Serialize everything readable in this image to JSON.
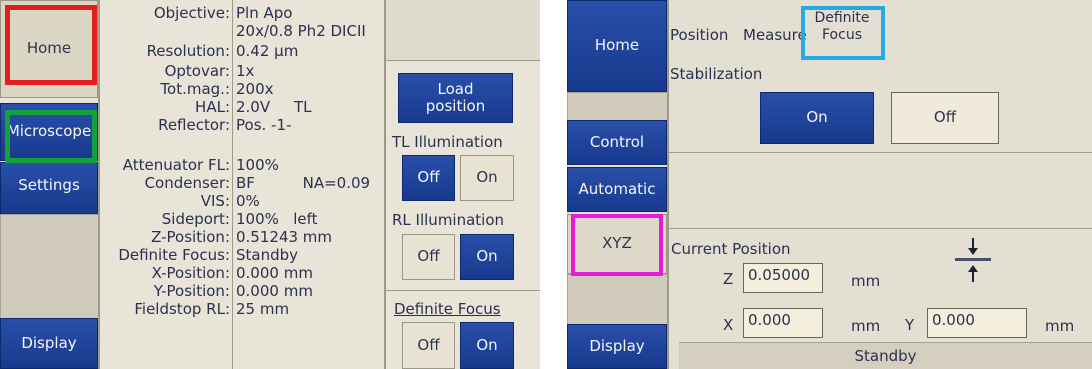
{
  "left": {
    "nav": {
      "home": "Home",
      "microscope": "Microscope",
      "settings": "Settings",
      "display": "Display"
    },
    "params": [
      {
        "label": "Objective:",
        "value": "Pln Apo"
      },
      {
        "label": "",
        "value": "20x/0.8 Ph2 DICII"
      },
      {
        "label": "Resolution:",
        "value": "0.42 µm"
      },
      {
        "label": "Optovar:",
        "value": "1x"
      },
      {
        "label": "Tot.mag.:",
        "value": "200x"
      },
      {
        "label": "HAL:",
        "value": "2.0V     TL"
      },
      {
        "label": "Reflector:",
        "value": "Pos. -1-"
      },
      {
        "label": "Attenuator FL:",
        "value": "100%"
      },
      {
        "label": "Condenser:",
        "value": "BF          NA=0.09"
      },
      {
        "label": "VIS:",
        "value": "0%"
      },
      {
        "label": "Sideport:",
        "value": "100%   left"
      },
      {
        "label": "Z-Position:",
        "value": "0.51243 mm"
      },
      {
        "label": "Definite Focus:",
        "value": "Standby"
      },
      {
        "label": "X-Position:",
        "value": "0.000 mm"
      },
      {
        "label": "Y-Position:",
        "value": "0.000 mm"
      },
      {
        "label": "Fieldstop RL:",
        "value": "25 mm"
      }
    ],
    "actions": {
      "load_position": "Load position",
      "tl_illumination": "TL Illumination",
      "tl_off": "Off",
      "tl_on": "On",
      "rl_illumination": "RL Illumination",
      "rl_off": "Off",
      "rl_on": "On",
      "definite_focus": "Definite Focus",
      "df_off": "Off",
      "df_on": "On"
    }
  },
  "right": {
    "nav": {
      "home": "Home",
      "control": "Control",
      "automatic": "Automatic",
      "xyz": "XYZ",
      "display": "Display"
    },
    "tabs": {
      "position": "Position",
      "measure": "Measure",
      "definite_focus": "Definite Focus"
    },
    "stabilization": {
      "label": "Stabilization",
      "on": "On",
      "off": "Off"
    },
    "current_position": {
      "title": "Current Position",
      "z_label": "Z",
      "z_value": "0.05000",
      "x_label": "X",
      "x_value": "0.000",
      "y_label": "Y",
      "y_value": "0.000",
      "unit": "mm"
    },
    "status": "Standby"
  }
}
